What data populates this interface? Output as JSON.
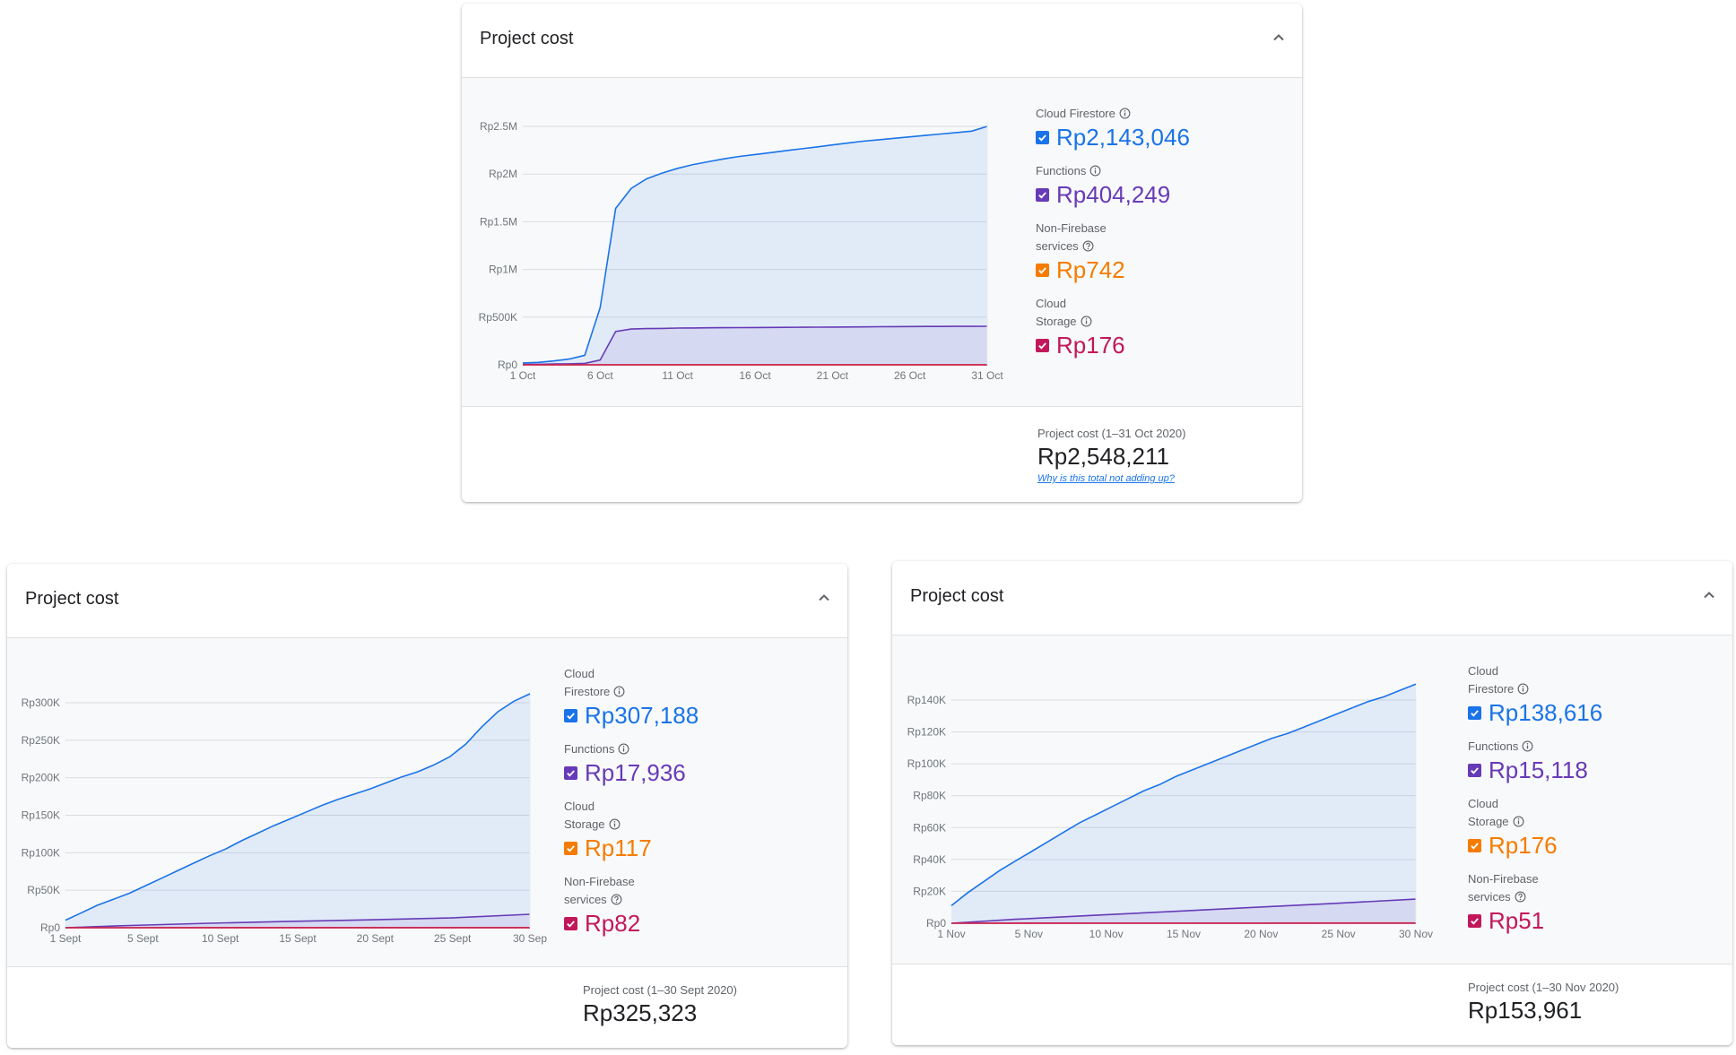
{
  "colors": {
    "firestore": "#1a73e8",
    "functions": "#673ab7",
    "non_firebase_oct": "#f57c00",
    "storage_oct": "#c2185b",
    "storage_sep_nov": "#f57c00",
    "non_firebase_sep_nov": "#c2185b"
  },
  "icons": {
    "collapse": "chevron-up-icon",
    "info": "info-icon",
    "help": "help-circle-icon",
    "checkbox": "checkbox-checked-icon"
  },
  "cards": {
    "oct": {
      "title": "Project cost",
      "legend": [
        {
          "name": "Cloud Firestore",
          "icon": "info",
          "value": "Rp2,143,046",
          "color": "#1a73e8"
        },
        {
          "name": "Functions",
          "icon": "info",
          "value": "Rp404,249",
          "color": "#673ab7"
        },
        {
          "name": "Non-Firebase services",
          "icon": "help",
          "value": "Rp742",
          "color": "#f57c00"
        },
        {
          "name": "Cloud Storage",
          "icon": "info",
          "value": "Rp176",
          "color": "#c2185b"
        }
      ],
      "total_label": "Project cost (1–31 Oct 2020)",
      "total_value": "Rp2,548,211",
      "total_link": "Why is this total not adding up?"
    },
    "sep": {
      "title": "Project cost",
      "legend": [
        {
          "name": "Cloud Firestore",
          "icon": "info",
          "value": "Rp307,188",
          "color": "#1a73e8"
        },
        {
          "name": "Functions",
          "icon": "info",
          "value": "Rp17,936",
          "color": "#673ab7"
        },
        {
          "name": "Cloud Storage",
          "icon": "info",
          "value": "Rp117",
          "color": "#f57c00"
        },
        {
          "name": "Non-Firebase services",
          "icon": "help",
          "value": "Rp82",
          "color": "#c2185b"
        }
      ],
      "total_label": "Project cost (1–30 Sept 2020)",
      "total_value": "Rp325,323"
    },
    "nov": {
      "title": "Project cost",
      "legend": [
        {
          "name": "Cloud Firestore",
          "icon": "info",
          "value": "Rp138,616",
          "color": "#1a73e8"
        },
        {
          "name": "Functions",
          "icon": "info",
          "value": "Rp15,118",
          "color": "#673ab7"
        },
        {
          "name": "Cloud Storage",
          "icon": "info",
          "value": "Rp176",
          "color": "#f57c00"
        },
        {
          "name": "Non-Firebase services",
          "icon": "help",
          "value": "Rp51",
          "color": "#c2185b"
        }
      ],
      "total_label": "Project cost (1–30 Nov 2020)",
      "total_value": "Rp153,961"
    }
  },
  "chart_data": [
    {
      "type": "area",
      "x_ticks": [
        "1 Oct",
        "6 Oct",
        "11 Oct",
        "16 Oct",
        "21 Oct",
        "26 Oct",
        "31 Oct"
      ],
      "y_ticks": [
        "Rp0",
        "Rp500K",
        "Rp1M",
        "Rp1.5M",
        "Rp2M",
        "Rp2.5M"
      ],
      "ylim": [
        0,
        2500000
      ],
      "xlim": [
        1,
        31
      ],
      "grid": true,
      "series": [
        {
          "name": "Cloud Firestore",
          "color": "#1a73e8",
          "x": [
            1,
            2,
            3,
            4,
            5,
            6,
            7,
            8,
            9,
            10,
            11,
            12,
            13,
            14,
            15,
            16,
            17,
            18,
            19,
            20,
            21,
            22,
            23,
            24,
            25,
            26,
            27,
            28,
            29,
            30,
            31
          ],
          "values": [
            20000,
            25000,
            40000,
            60000,
            100000,
            600000,
            1640000,
            1850000,
            1950000,
            2010000,
            2060000,
            2100000,
            2130000,
            2160000,
            2185000,
            2205000,
            2225000,
            2245000,
            2265000,
            2285000,
            2305000,
            2325000,
            2345000,
            2360000,
            2375000,
            2390000,
            2405000,
            2420000,
            2435000,
            2450000,
            2500000
          ]
        },
        {
          "name": "Functions",
          "color": "#673ab7",
          "x": [
            1,
            2,
            3,
            4,
            5,
            6,
            7,
            8,
            9,
            10,
            11,
            12,
            13,
            14,
            15,
            16,
            17,
            18,
            19,
            20,
            21,
            22,
            23,
            24,
            25,
            26,
            27,
            28,
            29,
            30,
            31
          ],
          "values": [
            5000,
            6000,
            8000,
            10000,
            15000,
            50000,
            350000,
            375000,
            380000,
            382000,
            385000,
            386000,
            388000,
            389000,
            390000,
            391000,
            392000,
            393000,
            394000,
            395000,
            396000,
            397000,
            398000,
            399000,
            400000,
            401000,
            402000,
            402500,
            403000,
            403500,
            404249
          ]
        },
        {
          "name": "Non-Firebase services",
          "color": "#f57c00",
          "x": [
            1,
            31
          ],
          "values": [
            0,
            742
          ]
        },
        {
          "name": "Cloud Storage",
          "color": "#c2185b",
          "x": [
            1,
            31
          ],
          "values": [
            0,
            176
          ]
        }
      ]
    },
    {
      "type": "area",
      "x_ticks": [
        "1 Sept",
        "5 Sept",
        "10 Sept",
        "15 Sept",
        "20 Sept",
        "25 Sept",
        "30 Sep"
      ],
      "y_ticks": [
        "Rp0",
        "Rp50K",
        "Rp100K",
        "Rp150K",
        "Rp200K",
        "Rp250K",
        "Rp300K"
      ],
      "ylim": [
        0,
        300000
      ],
      "xlim": [
        1,
        30
      ],
      "grid": true,
      "series": [
        {
          "name": "Cloud Firestore",
          "color": "#1a73e8",
          "x": [
            1,
            2,
            3,
            4,
            5,
            6,
            7,
            8,
            9,
            10,
            11,
            12,
            13,
            14,
            15,
            16,
            17,
            18,
            19,
            20,
            21,
            22,
            23,
            24,
            25,
            26,
            27,
            28,
            29,
            30
          ],
          "values": [
            10000,
            20000,
            30000,
            38000,
            46000,
            56000,
            66000,
            76000,
            86000,
            96000,
            105000,
            116000,
            126000,
            136000,
            145000,
            154000,
            163000,
            171000,
            178000,
            185000,
            193000,
            201000,
            208000,
            217000,
            228000,
            245000,
            268000,
            288000,
            302000,
            312000
          ]
        },
        {
          "name": "Functions",
          "color": "#673ab7",
          "x": [
            1,
            5,
            10,
            15,
            20,
            25,
            30
          ],
          "values": [
            0,
            3000,
            6000,
            8500,
            10500,
            13000,
            17936
          ]
        },
        {
          "name": "Cloud Storage",
          "color": "#f57c00",
          "x": [
            1,
            30
          ],
          "values": [
            0,
            117
          ]
        },
        {
          "name": "Non-Firebase services",
          "color": "#c2185b",
          "x": [
            1,
            30
          ],
          "values": [
            0,
            82
          ]
        }
      ]
    },
    {
      "type": "area",
      "x_ticks": [
        "1 Nov",
        "5 Nov",
        "10 Nov",
        "15 Nov",
        "20 Nov",
        "25 Nov",
        "30 Nov"
      ],
      "y_ticks": [
        "Rp0",
        "Rp20K",
        "Rp40K",
        "Rp60K",
        "Rp80K",
        "Rp100K",
        "Rp120K",
        "Rp140K"
      ],
      "ylim": [
        0,
        140000
      ],
      "xlim": [
        1,
        30
      ],
      "grid": true,
      "series": [
        {
          "name": "Cloud Firestore",
          "color": "#1a73e8",
          "x": [
            1,
            2,
            3,
            4,
            5,
            6,
            7,
            8,
            9,
            10,
            11,
            12,
            13,
            14,
            15,
            16,
            17,
            18,
            19,
            20,
            21,
            22,
            23,
            24,
            25,
            26,
            27,
            28,
            29,
            30
          ],
          "values": [
            11000,
            19000,
            26000,
            33000,
            39000,
            45000,
            51000,
            57000,
            63000,
            68000,
            73000,
            78000,
            83000,
            87000,
            92000,
            96000,
            100000,
            104000,
            108000,
            112000,
            116000,
            119000,
            123000,
            127000,
            131000,
            135000,
            139000,
            142000,
            146000,
            150000
          ]
        },
        {
          "name": "Functions",
          "color": "#673ab7",
          "x": [
            1,
            5,
            10,
            15,
            20,
            25,
            30
          ],
          "values": [
            0,
            2500,
            5000,
            7500,
            10000,
            12500,
            15118
          ]
        },
        {
          "name": "Cloud Storage",
          "color": "#f57c00",
          "x": [
            1,
            30
          ],
          "values": [
            0,
            176
          ]
        },
        {
          "name": "Non-Firebase services",
          "color": "#c2185b",
          "x": [
            1,
            30
          ],
          "values": [
            0,
            51
          ]
        }
      ]
    }
  ]
}
